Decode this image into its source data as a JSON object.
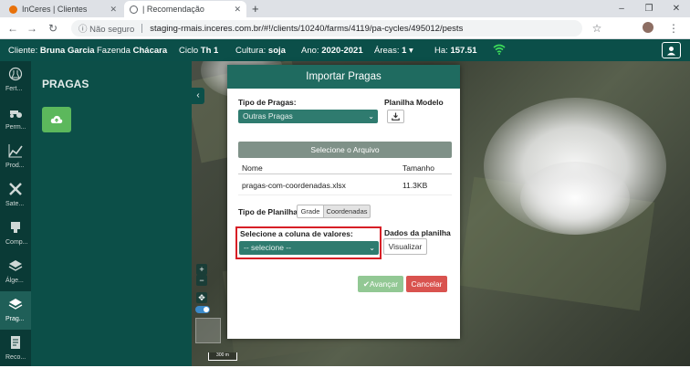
{
  "browser": {
    "tabs": [
      {
        "label": "InCeres | Clientes"
      },
      {
        "label": "| Recomendação"
      }
    ],
    "new_tab": "+",
    "insecure_label": "Não seguro",
    "url": "staging-rmais.inceres.com.br/#!/clients/10240/farms/4119/pa-cycles/495012/pests",
    "window_controls": [
      "–",
      "❐",
      "✕"
    ]
  },
  "header": {
    "cliente_label": "Cliente:",
    "cliente_value": "Bruna Garcia",
    "fazenda_label": "Fazenda",
    "fazenda_value": "Chácara",
    "ciclo_label": "Ciclo",
    "ciclo_value": "Th 1",
    "cultura_label": "Cultura:",
    "cultura_value": "soja",
    "ano_label": "Ano:",
    "ano_value": "2020-2021",
    "areas_label": "Áreas:",
    "areas_value": "1",
    "ha_label": "Ha:",
    "ha_value": "157.51"
  },
  "nav": [
    {
      "label": "Fert..."
    },
    {
      "label": "Perm..."
    },
    {
      "label": "Prod..."
    },
    {
      "label": "Sate..."
    },
    {
      "label": "Comp..."
    },
    {
      "label": "Álge..."
    },
    {
      "label": "Prag..."
    },
    {
      "label": "Reco..."
    }
  ],
  "panel": {
    "title": "PRAGAS"
  },
  "map": {
    "scale_label": "300 m"
  },
  "modal": {
    "title": "Importar Pragas",
    "tipo_pragas_label": "Tipo de Pragas:",
    "tipo_pragas_value": "Outras Pragas",
    "planilha_modelo_label": "Planilha Modelo",
    "select_file_label": "Selecione o Arquivo",
    "col_nome": "Nome",
    "col_tamanho": "Tamanho",
    "file_name": "pragas-com-coordenadas.xlsx",
    "file_size": "11.3KB",
    "tipo_planilha_label": "Tipo de Planilha:",
    "seg_grade": "Grade",
    "seg_coordenadas": "Coordenadas",
    "coluna_label": "Selecione a coluna de valores:",
    "coluna_placeholder": "-- selecione --",
    "dados_label": "Dados da planilha",
    "visualizar_label": "Visualizar",
    "avancar_label": "✔Avançar",
    "cancelar_label": "Cancelar"
  },
  "colors": {
    "header_bg": "#0b4f49",
    "panel_bg": "#0c4f48",
    "modal_header": "#1f6b60",
    "advance": "#92c894",
    "cancel": "#d9534f",
    "highlight": "#d71f26"
  }
}
